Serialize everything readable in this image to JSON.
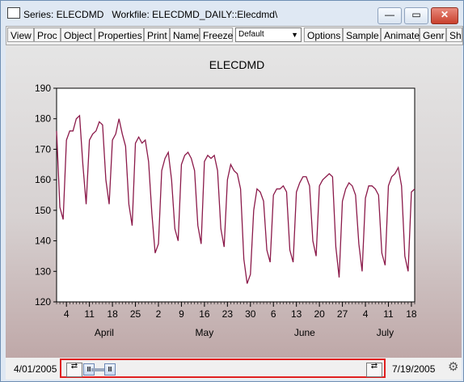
{
  "window": {
    "title": "Series: ELECDMD   Workfile: ELECDMD_DAILY::Elecdmd\\",
    "minimize_symbol": "—",
    "maximize_symbol": "▭",
    "close_symbol": "✕"
  },
  "toolbar": {
    "buttons": [
      "View",
      "Proc",
      "Object",
      "Properties",
      "Print",
      "Name",
      "Freeze",
      "Options",
      "Sample",
      "Animate",
      "Genr",
      "She"
    ],
    "format_select": "Default"
  },
  "range": {
    "start_date": "4/01/2005",
    "end_date": "7/19/2005"
  },
  "colors": {
    "line": "#8b1a4a",
    "highlight": "#e02020"
  },
  "chart_data": {
    "type": "line",
    "title": "ELECDMD",
    "xlabel": "",
    "ylabel": "",
    "ylim": [
      120,
      190
    ],
    "y_ticks": [
      120,
      130,
      140,
      150,
      160,
      170,
      180,
      190
    ],
    "x_tick_labels": [
      "4",
      "11",
      "18",
      "25",
      "2",
      "9",
      "16",
      "23",
      "30",
      "6",
      "13",
      "20",
      "27",
      "4",
      "11",
      "18"
    ],
    "month_labels": [
      "April",
      "May",
      "June",
      "July"
    ],
    "grid": false,
    "x_start": "2005-04-01",
    "x_end": "2005-07-19",
    "series": [
      {
        "name": "ELECDMD",
        "values": [
          176,
          151,
          147,
          173,
          176,
          176,
          180,
          181,
          165,
          152,
          173,
          175,
          176,
          179,
          178,
          160,
          152,
          173,
          175,
          180,
          175,
          171,
          152,
          145,
          172,
          174,
          172,
          173,
          166,
          149,
          136,
          139,
          163,
          167,
          169,
          160,
          144,
          140,
          165,
          168,
          169,
          167,
          163,
          145,
          139,
          166,
          168,
          167,
          168,
          163,
          144,
          138,
          160,
          165,
          163,
          162,
          157,
          134,
          126,
          129,
          150,
          157,
          156,
          153,
          137,
          133,
          155,
          157,
          157,
          158,
          156,
          137,
          133,
          156,
          159,
          161,
          161,
          158,
          140,
          135,
          158,
          160,
          161,
          162,
          161,
          138,
          128,
          153,
          157,
          159,
          158,
          155,
          139,
          130,
          154,
          158,
          158,
          157,
          155,
          136,
          132,
          158,
          161,
          162,
          164,
          158,
          135,
          130,
          156,
          157
        ]
      }
    ]
  }
}
